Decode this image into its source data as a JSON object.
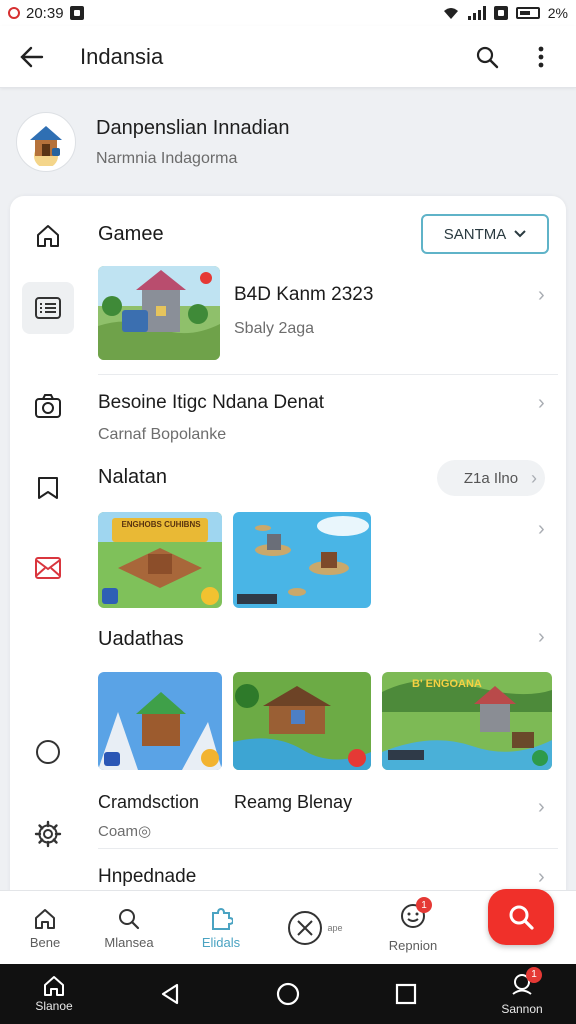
{
  "status_bar": {
    "time": "20:39",
    "battery": "2%"
  },
  "app_bar": {
    "title": "Indansia",
    "icons": [
      "back-arrow-icon",
      "search-icon",
      "more-vert-icon"
    ]
  },
  "profile": {
    "name": "Danpenslian Innadian",
    "subtitle": "Narmnia Indagorma"
  },
  "sections": {
    "games": {
      "title": "Gamee",
      "select_value": "SANTMA",
      "item": {
        "title": "B4D Kanm 2323",
        "subtitle": "Sbaly 2aga"
      }
    },
    "info_row": {
      "title": "Besoine Itigc Ndana Denat",
      "subtitle": "Carnaf Bopolanke"
    },
    "nalatan": {
      "title": "Nalatan",
      "pill_label": "Z1a Ilno",
      "thumb1_caption": "ENGHOBS CUHIBNS"
    },
    "uadathas": {
      "title": "Uadathas",
      "thumb3_caption": "B' ENGOANA"
    },
    "cramdsction": {
      "left_title": "Cramdsction",
      "left_sub": "Coam◎",
      "right_title": "Reamg Blenay"
    },
    "hnpednade": {
      "title": "Hnpednade"
    }
  },
  "rail_icons": [
    "home-icon",
    "list-icon",
    "camera-icon",
    "bookmark-icon",
    "mail-icon",
    "circle-icon",
    "settings-icon"
  ],
  "bottom_nav": {
    "items": [
      {
        "label": "Bene",
        "icon": "home-icon"
      },
      {
        "label": "Mlansea",
        "icon": "search-icon"
      },
      {
        "label": "Elidals",
        "icon": "puzzle-icon"
      },
      {
        "label": "",
        "icon": "compass-icon",
        "small_text": "ape"
      },
      {
        "label": "Repnion",
        "icon": "face-icon",
        "badge": "1"
      }
    ],
    "fab_icon": "search-icon"
  },
  "system_nav": {
    "left_label": "Slanoe",
    "right_label": "Sannon",
    "right_badge": "1"
  },
  "colors": {
    "accent": "#4aa3c2",
    "fab": "#f0302a",
    "select_border": "#5fb3c8",
    "rail_mail": "#d9363e"
  }
}
